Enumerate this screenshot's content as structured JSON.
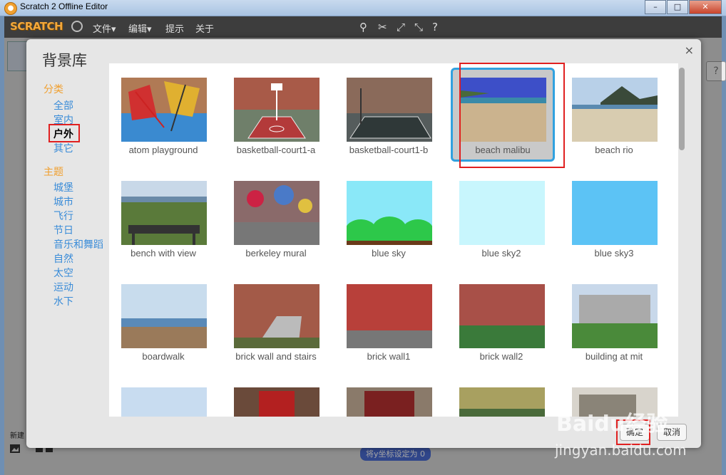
{
  "window": {
    "title": "Scratch 2 Offline Editor"
  },
  "menubar": {
    "logo": "SCRATCH",
    "items": [
      "文件▾",
      "编辑▾",
      "提示",
      "关于"
    ]
  },
  "dialog": {
    "title": "背景库",
    "close": "×",
    "category_heading": "分类",
    "categories": [
      "全部",
      "室内",
      "户外",
      "其它"
    ],
    "selected_category": "户外",
    "theme_heading": "主题",
    "themes": [
      "城堡",
      "城市",
      "飞行",
      "节日",
      "音乐和舞蹈",
      "自然",
      "太空",
      "运动",
      "水下"
    ],
    "ok_label": "确定",
    "cancel_label": "取消"
  },
  "backdrops": [
    "atom playground",
    "basketball-court1-a",
    "basketball-court1-b",
    "beach malibu",
    "beach rio",
    "bench with view",
    "berkeley mural",
    "blue sky",
    "blue sky2",
    "blue sky3",
    "boardwalk",
    "brick wall and stairs",
    "brick wall1",
    "brick wall2",
    "building at mit"
  ],
  "selected_backdrop": "beach malibu",
  "background": {
    "left_label": "新建",
    "block_label": "将y坐标设定为 0"
  },
  "watermark": {
    "text": "Baidu经验",
    "sub": "jingyan.baidu.com"
  }
}
